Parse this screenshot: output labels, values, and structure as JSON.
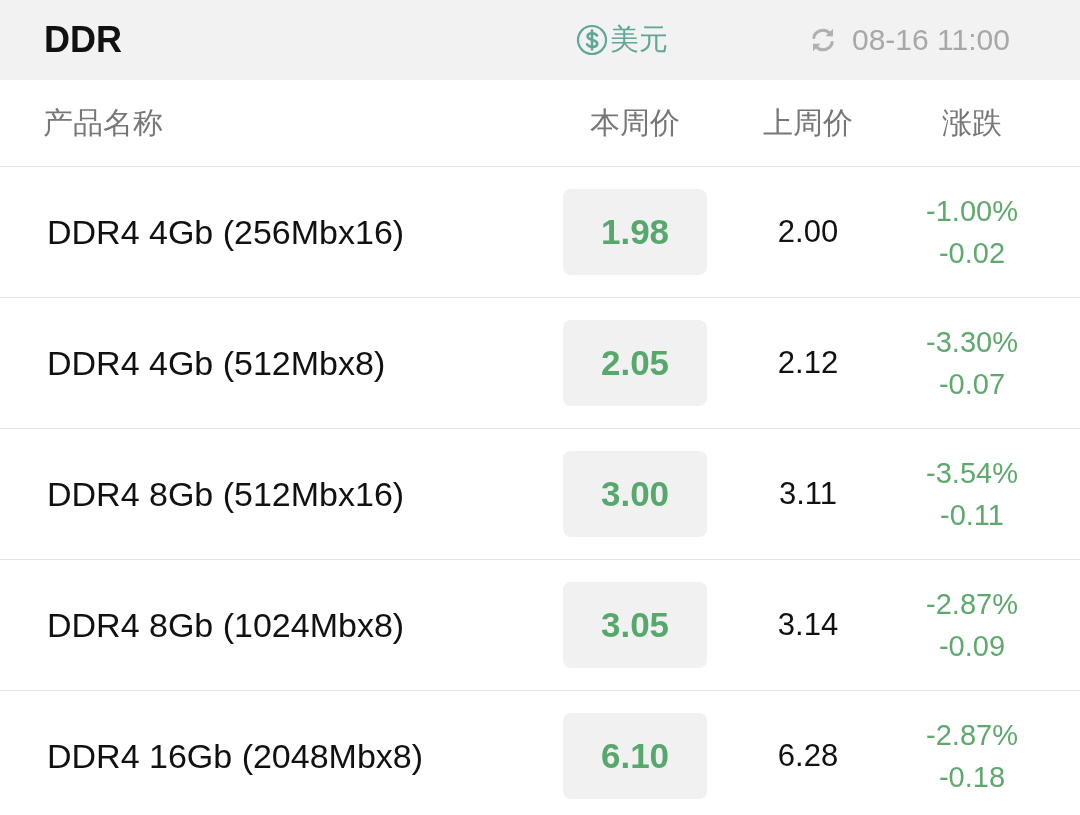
{
  "header": {
    "title": "DDR",
    "currency": "美元",
    "updated": "08-16 11:00"
  },
  "table": {
    "columns": [
      "产品名称",
      "本周价",
      "上周价",
      "涨跌"
    ],
    "rows": [
      {
        "name": "DDR4 4Gb (256Mbx16)",
        "this_week": "1.98",
        "last_week": "2.00",
        "change_pct": "-1.00%",
        "change": "-0.02"
      },
      {
        "name": "DDR4 4Gb (512Mbx8)",
        "this_week": "2.05",
        "last_week": "2.12",
        "change_pct": "-3.30%",
        "change": "-0.07"
      },
      {
        "name": "DDR4 8Gb (512Mbx16)",
        "this_week": "3.00",
        "last_week": "3.11",
        "change_pct": "-3.54%",
        "change": "-0.11"
      },
      {
        "name": "DDR4 8Gb (1024Mbx8)",
        "this_week": "3.05",
        "last_week": "3.14",
        "change_pct": "-2.87%",
        "change": "-0.09"
      },
      {
        "name": "DDR4 16Gb (2048Mbx8)",
        "this_week": "6.10",
        "last_week": "6.28",
        "change_pct": "-2.87%",
        "change": "-0.18"
      }
    ]
  }
}
